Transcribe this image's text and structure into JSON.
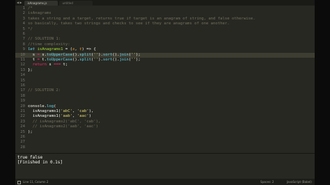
{
  "tabs": {
    "nav": "◀ ▶",
    "items": [
      {
        "label": "isAnagrams.js",
        "active": true
      },
      {
        "label": "untitled",
        "active": false
      }
    ]
  },
  "editor": {
    "current_line": 10,
    "lines": [
      {
        "n": "1",
        "t": [
          [
            "/*",
            "c"
          ]
        ]
      },
      {
        "n": "2",
        "t": [
          [
            "isAnagrams",
            "c"
          ]
        ]
      },
      {
        "n": "3",
        "t": [
          [
            "takes a string and a target, returns true if target is an anagram of string, and false otherwise.",
            "c"
          ]
        ]
      },
      {
        "n": "4",
        "t": [
          [
            "so basically, takes two strings and checks to see if they are anagrams of one another.",
            "c"
          ]
        ]
      },
      {
        "n": "5",
        "t": [
          [
            "*/",
            "c"
          ]
        ]
      },
      {
        "n": "6",
        "t": []
      },
      {
        "n": "7",
        "t": [
          [
            "// SOLUTION 1:",
            "c"
          ]
        ]
      },
      {
        "n": "8",
        "t": [
          [
            "//time complexity:",
            "c"
          ]
        ]
      },
      {
        "n": "9",
        "t": [
          [
            "let ",
            "k"
          ],
          [
            "isAnagrams1",
            "st"
          ],
          [
            " = (",
            "n"
          ],
          [
            "s",
            "p"
          ],
          [
            ", ",
            "n"
          ],
          [
            "t",
            "p"
          ],
          [
            ") => {",
            "n"
          ]
        ]
      },
      {
        "n": "10",
        "t": [
          [
            "  s ",
            "n"
          ],
          [
            "=",
            "kw"
          ],
          [
            " s.",
            "n"
          ],
          [
            "toUpperCase",
            "f"
          ],
          [
            "().",
            "n"
          ],
          [
            "split",
            "f"
          ],
          [
            "(",
            "n"
          ],
          [
            "''",
            "s"
          ],
          [
            ").",
            "n"
          ],
          [
            "sort",
            "f"
          ],
          [
            "().",
            "n"
          ],
          [
            "join",
            "f"
          ],
          [
            "(",
            "n"
          ],
          [
            "''",
            "s"
          ],
          [
            ");",
            "n"
          ]
        ]
      },
      {
        "n": "11",
        "t": [
          [
            "  t ",
            "n"
          ],
          [
            "=",
            "kw"
          ],
          [
            " t.",
            "n"
          ],
          [
            "toUpperCase",
            "f"
          ],
          [
            "().",
            "n"
          ],
          [
            "split",
            "f"
          ],
          [
            "(",
            "n"
          ],
          [
            "''",
            "s"
          ],
          [
            ").",
            "n"
          ],
          [
            "sort",
            "f"
          ],
          [
            "().",
            "n"
          ],
          [
            "join",
            "f"
          ],
          [
            "(",
            "n"
          ],
          [
            "''",
            "s"
          ],
          [
            ");",
            "n"
          ]
        ]
      },
      {
        "n": "12",
        "t": [
          [
            "  ",
            "n"
          ],
          [
            "return",
            "kw"
          ],
          [
            " s ",
            "n"
          ],
          [
            "===",
            "kw"
          ],
          [
            " t;",
            "n"
          ]
        ]
      },
      {
        "n": "13",
        "t": [
          [
            "};",
            "n"
          ]
        ]
      },
      {
        "n": "14",
        "t": []
      },
      {
        "n": "15",
        "t": []
      },
      {
        "n": "16",
        "t": []
      },
      {
        "n": "17",
        "t": [
          [
            "// SOLUTION 2:",
            "c"
          ]
        ]
      },
      {
        "n": "18",
        "t": []
      },
      {
        "n": "19",
        "t": []
      },
      {
        "n": "20",
        "t": [
          [
            "console",
            "n"
          ],
          [
            ".",
            "n"
          ],
          [
            "log",
            "f"
          ],
          [
            "(",
            "n"
          ]
        ]
      },
      {
        "n": "21",
        "t": [
          [
            "  isAnagrams1(",
            "n"
          ],
          [
            "'abC'",
            "s"
          ],
          [
            ", ",
            "n"
          ],
          [
            "'cab'",
            "s"
          ],
          [
            "),",
            "n"
          ]
        ]
      },
      {
        "n": "22",
        "t": [
          [
            "  isAnagrams1(",
            "n"
          ],
          [
            "'aab'",
            "s"
          ],
          [
            ", ",
            "n"
          ],
          [
            "'aac'",
            "s"
          ],
          [
            ")",
            "n"
          ]
        ]
      },
      {
        "n": "23",
        "t": [
          [
            "  // isAnagrams2('abC', 'cab'),",
            "c"
          ]
        ]
      },
      {
        "n": "24",
        "t": [
          [
            "  // isAnagrams2('aab', 'aac')",
            "c"
          ]
        ]
      },
      {
        "n": "25",
        "t": [
          [
            ");",
            "n"
          ]
        ]
      },
      {
        "n": "26",
        "t": []
      },
      {
        "n": "27",
        "t": []
      },
      {
        "n": "28",
        "t": []
      }
    ]
  },
  "output": {
    "lines": [
      "true false",
      "[Finished in 0.1s]"
    ]
  },
  "statusbar": {
    "position": "Line 11, Column 2",
    "spaces": "Spaces: 2",
    "syntax": "JavaScript (Babel)"
  }
}
